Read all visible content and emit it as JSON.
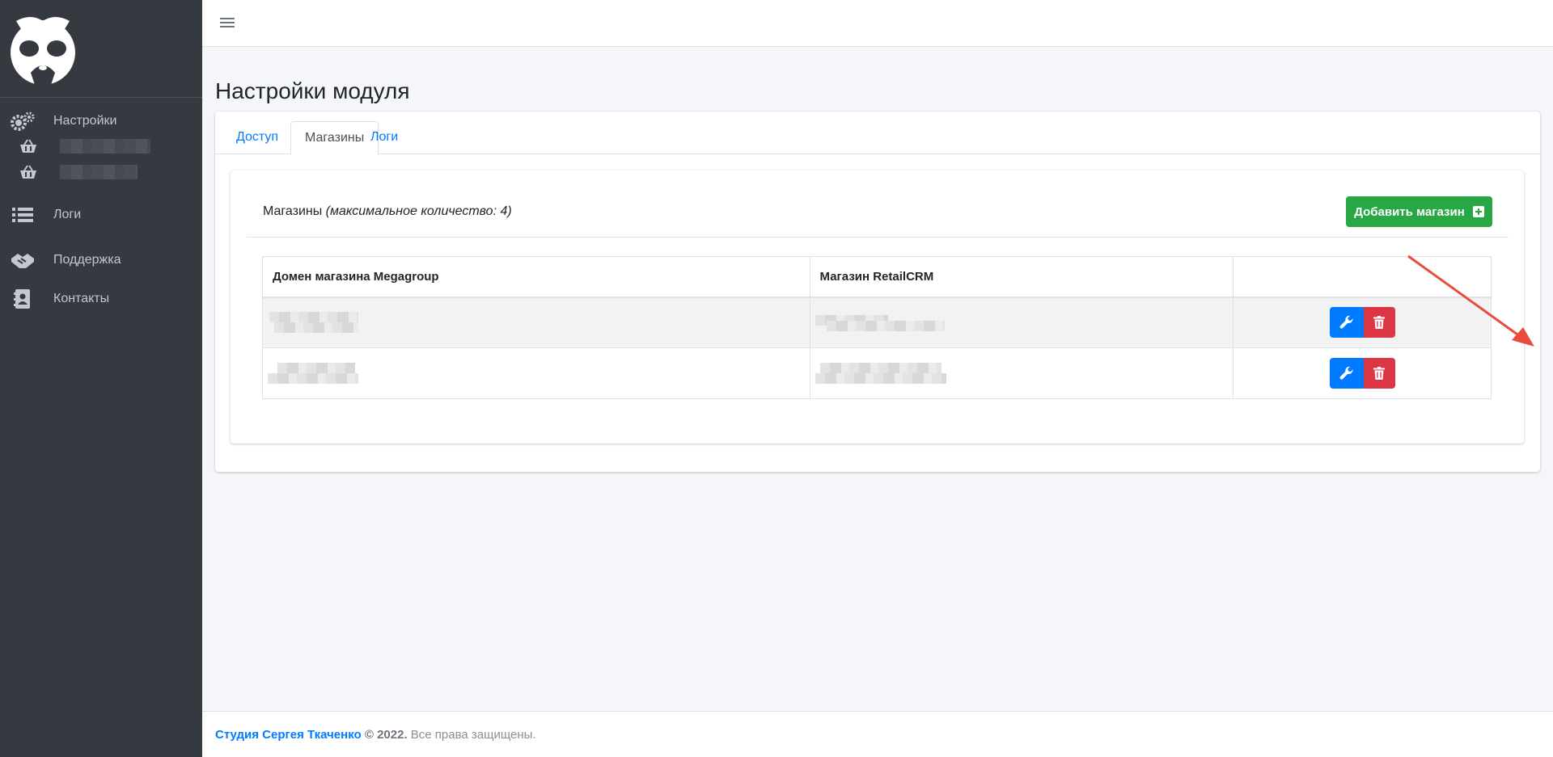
{
  "sidebar": {
    "items": [
      {
        "label": "Настройки",
        "icon": "gears-icon"
      },
      {
        "label": "Логи",
        "icon": "list-icon"
      },
      {
        "label": "Поддержка",
        "icon": "handshake-icon"
      },
      {
        "label": "Контакты",
        "icon": "address-book-icon"
      }
    ],
    "subitems": [
      {
        "icon": "basket-icon"
      },
      {
        "icon": "basket-icon"
      }
    ]
  },
  "page": {
    "title": "Настройки модуля"
  },
  "tabs": [
    {
      "label": "Доступ",
      "active": false
    },
    {
      "label": "Магазины",
      "active": true
    },
    {
      "label": "Логи",
      "active": false
    }
  ],
  "stores": {
    "title": "Магазины",
    "subtitle": "(максимальное количество: 4)",
    "add_button": "Добавить магазин",
    "columns": [
      "Домен магазина Megagroup",
      "Магазин RetailCRM",
      ""
    ],
    "rows": [
      {
        "domain": "",
        "retailcrm": ""
      },
      {
        "domain": "",
        "retailcrm": ""
      }
    ]
  },
  "footer": {
    "studio": "Студия Сергея Ткаченко",
    "copyright": "© 2022.",
    "rights": "Все права защищены."
  },
  "colors": {
    "sidebar_bg": "#343a40",
    "primary": "#007bff",
    "success": "#28a745",
    "danger": "#dc3545",
    "arrow": "#e74c3c"
  }
}
